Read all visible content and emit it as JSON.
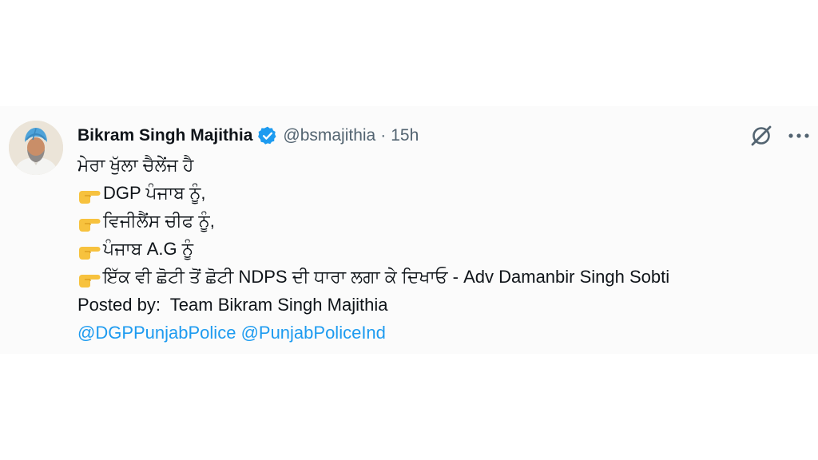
{
  "tweet": {
    "author_name": "Bikram Singh Majithia",
    "handle": "@bsmajithia",
    "separator": "·",
    "time": "15h",
    "lines": [
      {
        "emoji": null,
        "text": "ਮੇਰਾ ਖੁੱਲਾ ਚੈਲੇਂਜ ਹੈ"
      },
      {
        "emoji": "backhand-index-pointing-right",
        "text": "DGP ਪੰਜਾਬ ਨੂੰ,"
      },
      {
        "emoji": "backhand-index-pointing-right",
        "text": "ਵਿਜੀਲੈਂਸ ਚੀਫ ਨੂੰ,"
      },
      {
        "emoji": "backhand-index-pointing-right",
        "text": "ਪੰਜਾਬ A.G ਨੂੰ"
      },
      {
        "emoji": "backhand-index-pointing-right",
        "text": "ਇੱਕ ਵੀ ਛੋਟੀ ਤੋਂ ਛੋਟੀ NDPS ਦੀ ਧਾਰਾ ਲਗਾ ਕੇ ਦਿਖਾਓ - Adv Damanbir Singh Sobti"
      }
    ],
    "posted_by": "Posted by:  Team Bikram Singh Majithia",
    "mentions": [
      "@DGPPunjabPolice",
      "@PunjabPoliceInd"
    ]
  },
  "colors": {
    "link": "#1d9bf0",
    "verified": "#1d9bf0",
    "secondary_text": "#536471",
    "emoji_hand": "#f7c23e"
  },
  "icons": {
    "verified": "verified-badge-icon",
    "grok": "grok-icon",
    "more": "more-options-icon",
    "pointer": "pointing-right-emoji-icon"
  }
}
